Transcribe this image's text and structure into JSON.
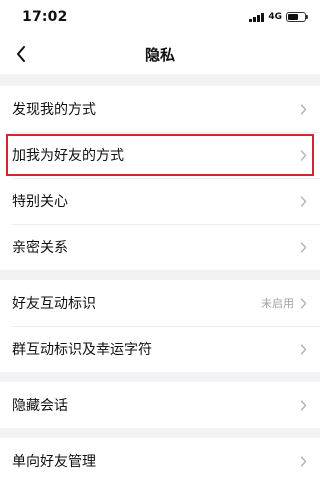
{
  "status_bar": {
    "time": "17:02",
    "network": "4G",
    "battery_level": 0.6
  },
  "nav": {
    "title": "隐私",
    "back_icon": "chevron-left-icon"
  },
  "groups": [
    {
      "items": [
        {
          "label": "发现我的方式",
          "value": ""
        },
        {
          "label": "加我为好友的方式",
          "value": "",
          "highlighted": true
        },
        {
          "label": "特别关心",
          "value": ""
        },
        {
          "label": "亲密关系",
          "value": ""
        }
      ]
    },
    {
      "items": [
        {
          "label": "好友互动标识",
          "value": "未启用"
        },
        {
          "label": "群互动标识及幸运字符",
          "value": ""
        }
      ]
    },
    {
      "items": [
        {
          "label": "隐藏会话",
          "value": ""
        }
      ]
    },
    {
      "items": [
        {
          "label": "单向好友管理",
          "value": ""
        }
      ]
    }
  ],
  "colors": {
    "background": "#f2f2f4",
    "highlight_border": "#d0282e",
    "secondary_text": "#a0a0a0",
    "chevron": "#b5b5b5"
  }
}
